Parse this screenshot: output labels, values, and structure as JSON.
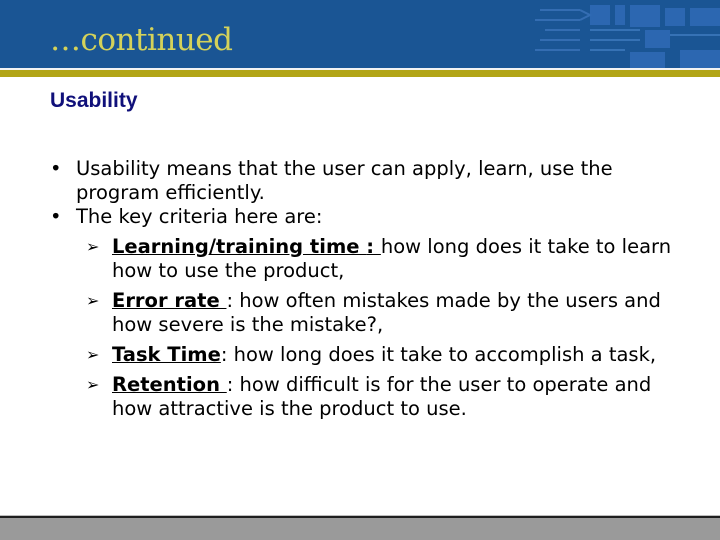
{
  "slide": {
    "title": "…continued",
    "subtitle": "Usability",
    "bullets": [
      {
        "text": "Usability means that the user can apply, learn, use the program efficiently."
      },
      {
        "text": "The key criteria here are:"
      }
    ],
    "criteria": [
      {
        "term": "Learning/training time ",
        "sep": ": ",
        "desc": "how long does it take to learn how to use the product,"
      },
      {
        "term": "Error rate ",
        "sep": ": ",
        "desc": "how often mistakes made by the users and how severe is the mistake?,"
      },
      {
        "term": "Task Time",
        "sep": ": ",
        "desc": "how long does it take to accomplish a task,"
      },
      {
        "term": "Retention ",
        "sep": ": ",
        "desc": "how difficult is for the user to operate and how attractive is the product to use."
      }
    ],
    "bullet_glyph": "•",
    "sub_bullet_glyph": "➢"
  },
  "colors": {
    "header_bg": "#1a5594",
    "title": "#d4d25a",
    "accent_band": "#b2a516",
    "subtitle": "#10107a",
    "footer": "#9a9a9a"
  }
}
